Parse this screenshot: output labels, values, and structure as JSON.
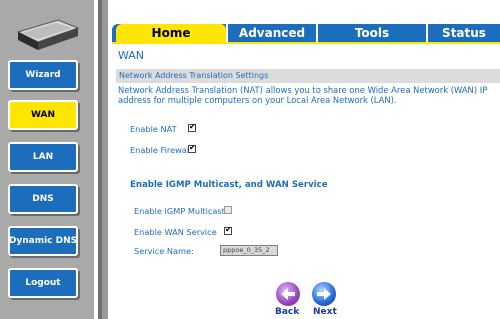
{
  "sidebar": {
    "items": [
      {
        "label": "Wizard",
        "active": false
      },
      {
        "label": "WAN",
        "active": true
      },
      {
        "label": "LAN",
        "active": false
      },
      {
        "label": "DNS",
        "active": false
      },
      {
        "label": "Dynamic DNS",
        "active": false
      },
      {
        "label": "Logout",
        "active": false
      }
    ],
    "device_icon": "router-icon"
  },
  "tabs": [
    {
      "label": "Home",
      "active": true
    },
    {
      "label": "Advanced",
      "active": false
    },
    {
      "label": "Tools",
      "active": false
    },
    {
      "label": "Status",
      "active": false
    }
  ],
  "page": {
    "title": "WAN",
    "section_title": "Network Address Translation Settings",
    "description": "Network Address Translation (NAT) allows you to share one Wide Area Network (WAN) IP address for multiple computers on your Local Area Network (LAN).",
    "enable_nat": {
      "label": "Enable NAT",
      "checked": true
    },
    "enable_firewall": {
      "label": "Enable Firewall",
      "checked": true
    },
    "igmp_heading": "Enable IGMP Multicast, and WAN Service",
    "enable_igmp": {
      "label": "Enable IGMP Multicast",
      "checked": false,
      "disabled": true
    },
    "enable_wan_service": {
      "label": "Enable WAN Service",
      "checked": true
    },
    "service_name": {
      "label": "Service Name:",
      "value": "pppoe_0_35_2"
    }
  },
  "buttons": {
    "back": "Back",
    "next": "Next"
  },
  "colors": {
    "accent_blue": "#1c6ebd",
    "highlight_yellow": "#ffe600",
    "sidebar_gray": "#a9a9a9"
  }
}
